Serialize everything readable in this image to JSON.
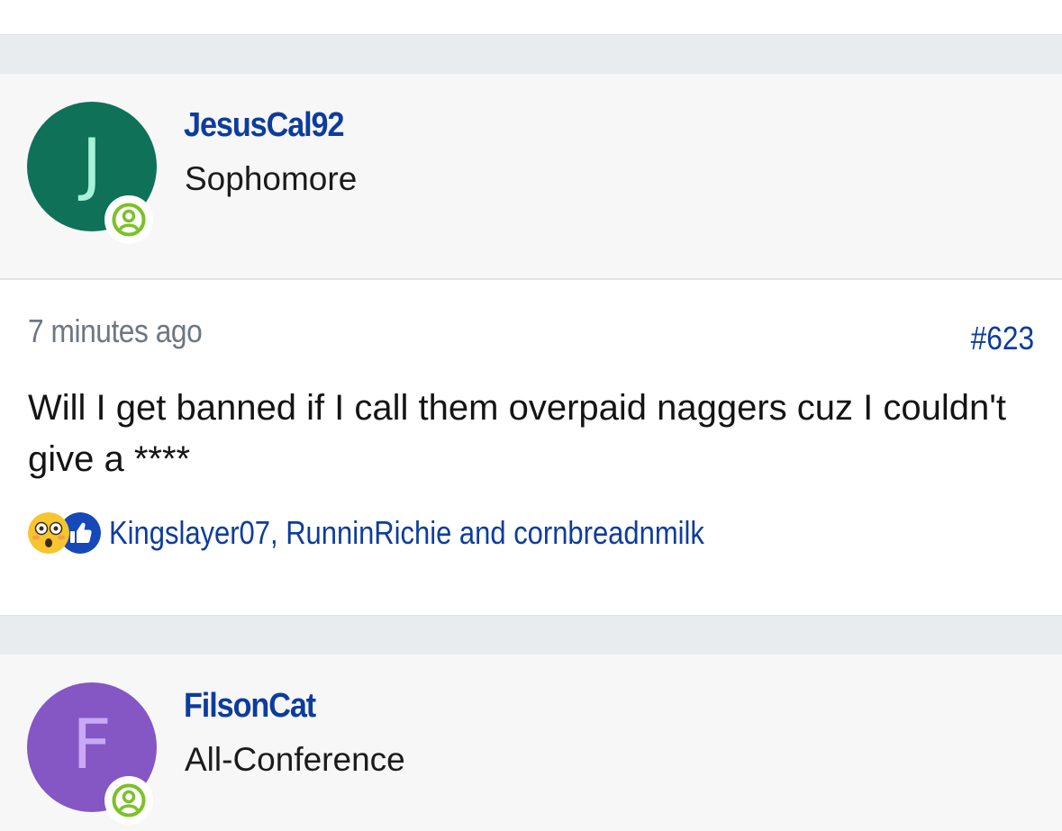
{
  "posts": [
    {
      "author": {
        "username": "JesusCal92",
        "title": "Sophomore",
        "avatar_letter": "J",
        "avatar_bg": "#0e7158",
        "avatar_fg": "#a6f2d9",
        "online_icon": "user-circle-icon"
      },
      "timestamp": "7 minutes ago",
      "post_number": "#623",
      "body": "Will I get banned if I call them overpaid naggers cuz I couldn't give a ****",
      "reactions": {
        "icons": [
          "shocked-face-icon",
          "thumbs-up-icon"
        ],
        "names": "Kingslayer07, RunninRichie and cornbreadnmilk"
      }
    },
    {
      "author": {
        "username": "FilsonCat",
        "title": "All-Conference",
        "avatar_letter": "F",
        "avatar_bg": "#8457c4",
        "avatar_fg": "#c9a8f5",
        "online_icon": "user-circle-icon"
      }
    }
  ],
  "colors": {
    "link": "#0d3c9e",
    "online": "#7cc127",
    "muted": "#6e7681"
  }
}
